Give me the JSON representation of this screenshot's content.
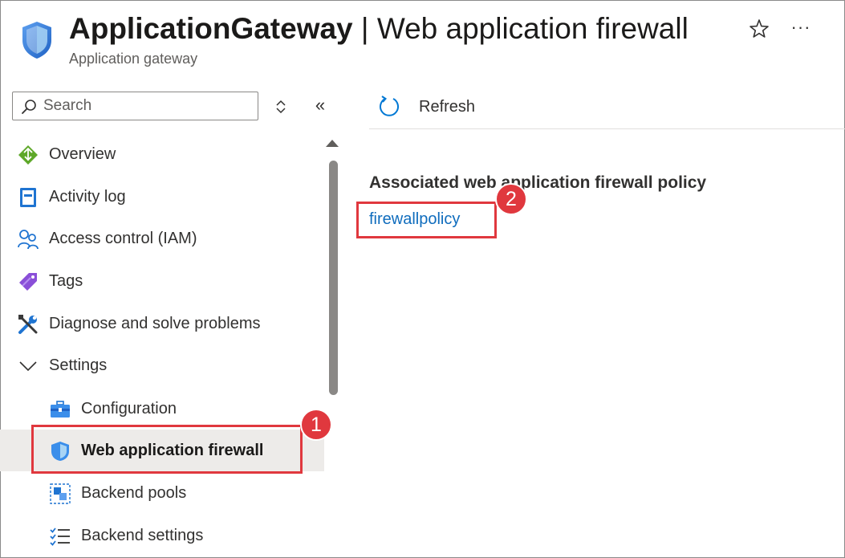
{
  "header": {
    "resource_name": "ApplicationGateway",
    "separator": " | ",
    "page_name": "Web application firewall",
    "subtitle": "Application gateway",
    "icon": "shield-icon",
    "favorite_icon": "star-icon",
    "more_label": "···"
  },
  "sidebar": {
    "search": {
      "placeholder": "Search",
      "value": ""
    },
    "collapse_label": "«",
    "items": [
      {
        "label": "Overview",
        "icon": "overview-icon"
      },
      {
        "label": "Activity log",
        "icon": "activity-log-icon"
      },
      {
        "label": "Access control (IAM)",
        "icon": "people-icon"
      },
      {
        "label": "Tags",
        "icon": "tag-icon"
      },
      {
        "label": "Diagnose and solve problems",
        "icon": "wrench-icon"
      },
      {
        "label": "Settings",
        "icon": "chevron-down-icon"
      },
      {
        "label": "Configuration",
        "icon": "briefcase-icon"
      },
      {
        "label": "Web application firewall",
        "icon": "shield-icon",
        "selected": true
      },
      {
        "label": "Backend pools",
        "icon": "backend-pool-icon"
      },
      {
        "label": "Backend settings",
        "icon": "checklist-icon"
      }
    ]
  },
  "toolbar": {
    "refresh_label": "Refresh"
  },
  "main": {
    "section_title": "Associated web application firewall policy",
    "policy_link": "firewallpolicy"
  },
  "annotations": {
    "step1": "1",
    "step2": "2",
    "color": "#e0383e"
  },
  "colors": {
    "link": "#0f6cbd",
    "selected_bg": "#edebe9",
    "accent_blue": "#0078d4"
  }
}
